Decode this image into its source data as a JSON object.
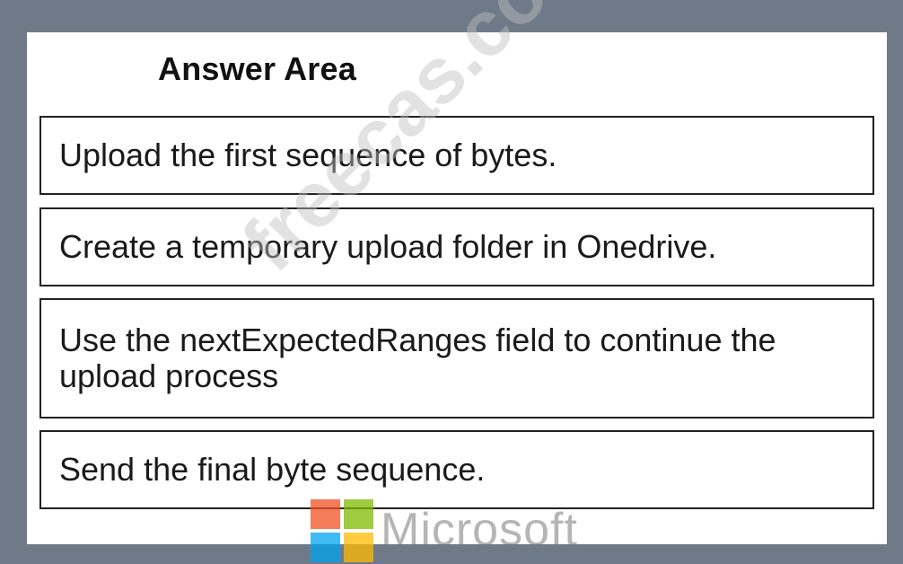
{
  "answer_area": {
    "title": "Answer Area",
    "items": [
      {
        "label": "Upload the first sequence of bytes."
      },
      {
        "label": "Create a temporary upload folder in Onedrive."
      },
      {
        "label": "Use the nextExpectedRanges field to continue the upload process"
      },
      {
        "label": "Send the final byte sequence."
      }
    ]
  },
  "watermark": {
    "site_text": "freecas.com",
    "brand_text": "Microsoft"
  },
  "colors": {
    "frame": "#6f7a89",
    "panel": "#ffffff",
    "border": "#222222",
    "text": "#1a1a1a",
    "logo_red": "#f25022",
    "logo_green": "#7fba00",
    "logo_blue": "#00a4ef",
    "logo_yellow": "#ffb900"
  }
}
